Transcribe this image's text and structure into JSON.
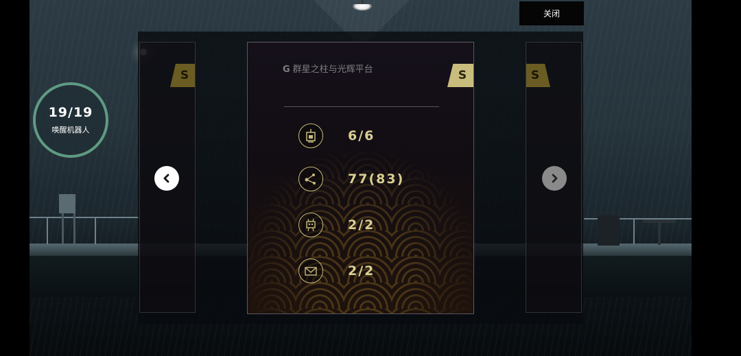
{
  "hud": {
    "counter_value": "19/19",
    "counter_label": "唤醒机器人",
    "close_label": "关闭"
  },
  "level_card": {
    "code": "G",
    "title": "群星之柱与光辉平台",
    "rank": "S",
    "stats": [
      {
        "icon": "lantern-icon",
        "value": "6/6"
      },
      {
        "icon": "connection-nodes-icon",
        "value": "77(83)"
      },
      {
        "icon": "robot-icon",
        "value": "2/2"
      },
      {
        "icon": "envelope-icon",
        "value": "2/2"
      }
    ]
  },
  "side_cards": {
    "left_rank": "S",
    "right_rank": "S"
  },
  "colors": {
    "accent_gold": "#c9bd7d",
    "stat_text": "#d9cf92",
    "counter_ring": "#5f9a82"
  }
}
